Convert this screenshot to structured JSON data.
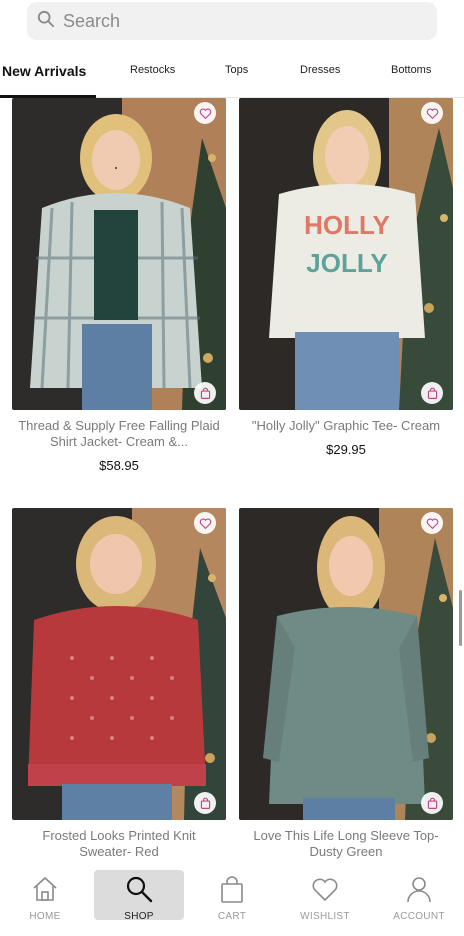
{
  "search": {
    "placeholder": "Search"
  },
  "tabs": [
    {
      "label": "New Arrivals",
      "active": true
    },
    {
      "label": "Restocks"
    },
    {
      "label": "Tops"
    },
    {
      "label": "Dresses"
    },
    {
      "label": "Bottoms"
    }
  ],
  "products": [
    {
      "title": "Thread & Supply Free Falling Plaid Shirt Jacket- Cream &...",
      "price": "$58.95",
      "color": "plaid-blue-gray"
    },
    {
      "title": "\"Holly Jolly\" Graphic Tee- Cream",
      "price": "$29.95",
      "shirt_text": "HOLLY JOLLY",
      "color": "cream"
    },
    {
      "title": "Frosted Looks Printed Knit Sweater- Red",
      "price": "",
      "color": "#b8393c"
    },
    {
      "title": "Love This Life Long Sleeve Top- Dusty Green",
      "price": "",
      "color": "#6f8b85"
    }
  ],
  "nav": [
    {
      "label": "HOME",
      "icon": "home-icon"
    },
    {
      "label": "SHOP",
      "icon": "search-icon",
      "active": true
    },
    {
      "label": "CART",
      "icon": "bag-icon"
    },
    {
      "label": "WISHLIST",
      "icon": "heart-icon"
    },
    {
      "label": "ACCOUNT",
      "icon": "account-icon"
    }
  ],
  "colors": {
    "accent_pink": "#c2468a",
    "text_gray": "#7a7a7a",
    "active_nav_bg": "#dcdcdc"
  }
}
